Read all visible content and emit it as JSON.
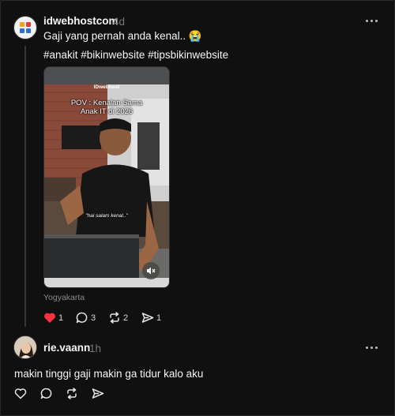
{
  "post": {
    "username": "idwebhostcom",
    "time": "4d",
    "text": "Gaji yang pernah anda kenal.. 😭",
    "hashtags": "#anakit #bikinwebsite #tipsbikinwebsite",
    "media": {
      "brand": "IDwebhost",
      "overlay_title_line1": "POV : Kenalan Sama",
      "overlay_title_line2": "Anak IT di 2026",
      "caption": "\"hai salam kenal..\"",
      "muted": true
    },
    "location": "Yogyakarta",
    "actions": {
      "like_count": "1",
      "liked": true,
      "comment_count": "3",
      "repost_count": "2",
      "share_count": "1"
    }
  },
  "reply": {
    "username": "rie.vaann",
    "time": "1h",
    "text": "makin tinggi gaji makin ga tidur kalo aku"
  },
  "colors": {
    "background": "#101010",
    "text_primary": "#f3f5f7",
    "text_secondary": "#777777",
    "like_active": "#ff3040"
  },
  "icons": [
    "heart-icon",
    "comment-icon",
    "repost-icon",
    "share-icon",
    "more-icon",
    "mute-icon"
  ]
}
